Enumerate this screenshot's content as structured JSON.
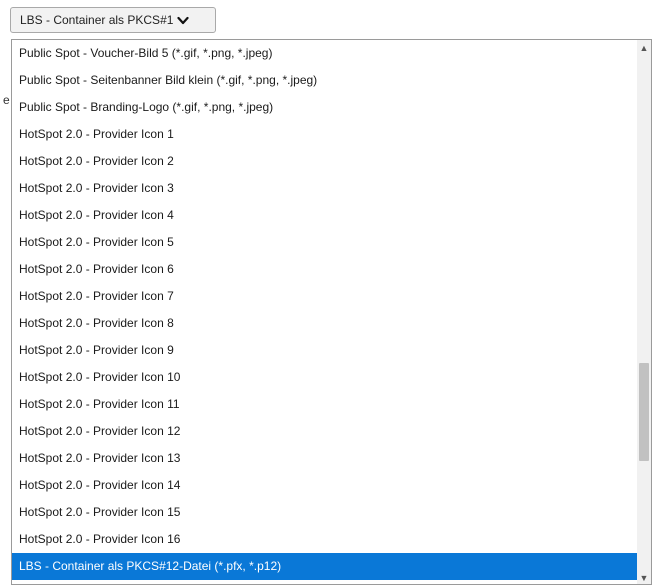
{
  "select": {
    "value": "LBS - Container als PKCS#1",
    "arrow_icon": "chevron-down-icon"
  },
  "background_fragment": "e",
  "dropdown": {
    "options": [
      "Public Spot - Voucher-Bild 5 (*.gif, *.png, *.jpeg)",
      "Public Spot - Seitenbanner Bild klein (*.gif, *.png, *.jpeg)",
      "Public Spot - Branding-Logo (*.gif, *.png, *.jpeg)",
      "HotSpot 2.0 - Provider Icon 1",
      "HotSpot 2.0 - Provider Icon 2",
      "HotSpot 2.0 - Provider Icon 3",
      "HotSpot 2.0 - Provider Icon 4",
      "HotSpot 2.0 - Provider Icon 5",
      "HotSpot 2.0 - Provider Icon 6",
      "HotSpot 2.0 - Provider Icon 7",
      "HotSpot 2.0 - Provider Icon 8",
      "HotSpot 2.0 - Provider Icon 9",
      "HotSpot 2.0 - Provider Icon 10",
      "HotSpot 2.0 - Provider Icon 11",
      "HotSpot 2.0 - Provider Icon 12",
      "HotSpot 2.0 - Provider Icon 13",
      "HotSpot 2.0 - Provider Icon 14",
      "HotSpot 2.0 - Provider Icon 15",
      "HotSpot 2.0 - Provider Icon 16",
      "LBS - Container als PKCS#12-Datei (*.pfx, *.p12)"
    ],
    "selected_index": 19,
    "selected_color": "#0a78d7"
  }
}
